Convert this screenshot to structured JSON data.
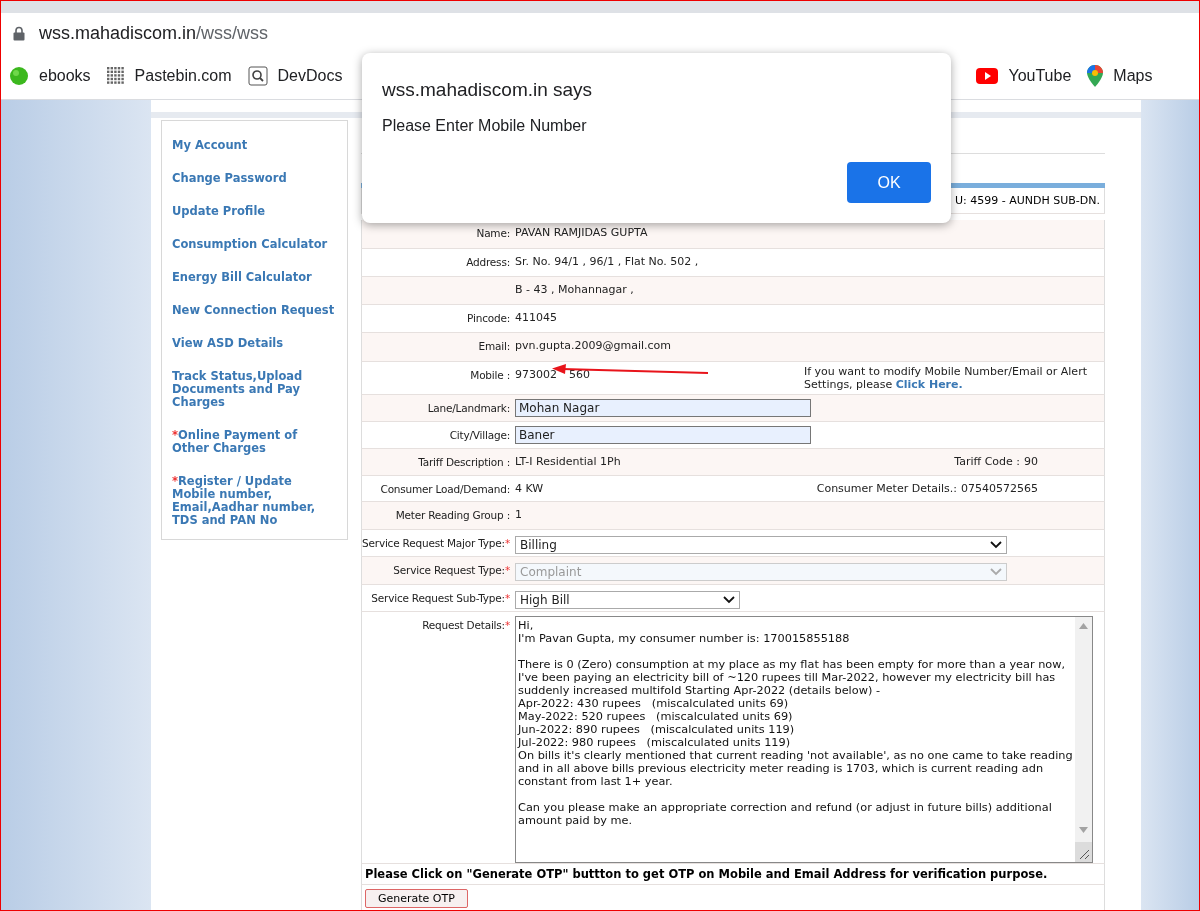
{
  "browser": {
    "url_host": "wss.mahadiscom.in",
    "url_path": "/wss/wss",
    "bookmarks": [
      {
        "label": "ebooks",
        "kind": "green"
      },
      {
        "label": "Pastebin.com",
        "kind": "grid"
      },
      {
        "label": "DevDocs",
        "kind": "search"
      },
      {
        "label": "YouTube",
        "kind": "youtube"
      },
      {
        "label": "Maps",
        "kind": "maps"
      }
    ]
  },
  "sidebar": {
    "items": [
      {
        "label": "My Account"
      },
      {
        "label": "Change Password"
      },
      {
        "label": "Update Profile"
      },
      {
        "label": "Consumption Calculator"
      },
      {
        "label": "Energy Bill Calculator"
      },
      {
        "label": "New Connection Request"
      },
      {
        "label": "View ASD Details"
      },
      {
        "label": "Track Status,Upload Documents and Pay Charges"
      },
      {
        "label": "Online Payment of Other Charges",
        "star": "*"
      },
      {
        "label": "Register / Update Mobile number, Email,Aadhar number, TDS and PAN No",
        "star": "*"
      }
    ]
  },
  "form": {
    "header_fragment": "U: 4599 - AUNDH SUB-DN.",
    "rows": [
      {
        "kind": "text",
        "label": "Name:",
        "value": "PAVAN RAMJIDAS GUPTA"
      },
      {
        "kind": "text",
        "label": "Address:",
        "value": "Sr. No. 94/1 , 96/1 , Flat No. 502 ,"
      },
      {
        "kind": "text",
        "value": "B - 43 , Mohannagar ,"
      },
      {
        "kind": "text",
        "label": "Pincode:",
        "value": "411045"
      },
      {
        "kind": "text",
        "label": "Email:",
        "value": "pvn.gupta.2009@gmail.com"
      },
      {
        "kind": "mobile",
        "label": "Mobile :",
        "value": "973002",
        "value_tail": "560",
        "note": "If you want to modify Mobile Number/Email or Alert Settings, please",
        "link": "Click Here."
      },
      {
        "kind": "input",
        "label": "Lane/Landmark:",
        "value": "Mohan Nagar"
      },
      {
        "kind": "input",
        "label": "City/Village:",
        "value": "Baner"
      },
      {
        "kind": "pair",
        "label": "Tariff Description :",
        "value": "LT-I Residential 1Ph",
        "side_label": "Tariff Code :",
        "side_value": "90"
      },
      {
        "kind": "pair",
        "label": "Consumer Load/Demand:",
        "value": "4 KW",
        "side_label": "Consumer Meter Details.:",
        "side_value": "07540572565"
      },
      {
        "kind": "text",
        "label": "Meter Reading Group :",
        "value": "1"
      },
      {
        "kind": "select",
        "label": "Service Request Major Type:",
        "required": "*",
        "value": "Billing",
        "disabled": false,
        "wide": true
      },
      {
        "kind": "select",
        "label": "Service Request Type:",
        "required": "*",
        "value": "Complaint",
        "disabled": true,
        "wide": true
      },
      {
        "kind": "select",
        "label": "Service Request Sub-Type:",
        "required": "*",
        "value": "High Bill",
        "disabled": false,
        "wide": false
      },
      {
        "kind": "textarea",
        "label": "Request Details:",
        "required": "*",
        "value": "Hi,\nI'm Pavan Gupta, my consumer number is: 170015855188\n\nThere is 0 (Zero) consumption at my place as my flat has been empty for more than a year now, I've been paying an electricity bill of ~120 rupees till Mar-2022, however my electricity bill has suddenly increased multifold Starting Apr-2022 (details below) -\nApr-2022: 430 rupees   (miscalculated units 69)\nMay-2022: 520 rupees   (miscalculated units 69)\nJun-2022: 890 rupees   (miscalculated units 119)\nJul-2022: 980 rupees   (miscalculated units 119)\nOn bills it's clearly mentioned that current reading 'not available', as no one came to take reading and in all above bills previous electricity meter reading is 1703, which is current reading adn constant from last 1+ year.\n\nCan you please make an appropriate correction and refund (or adjust in future bills) additional amount paid by me."
      }
    ],
    "notice": "Please Click on \"Generate OTP\" buttton to get OTP on Mobile and Email Address for verification purpose.",
    "button": "Generate OTP"
  },
  "dialog": {
    "title": "wss.mahadiscom.in says",
    "message": "Please Enter Mobile Number",
    "button": "OK"
  }
}
